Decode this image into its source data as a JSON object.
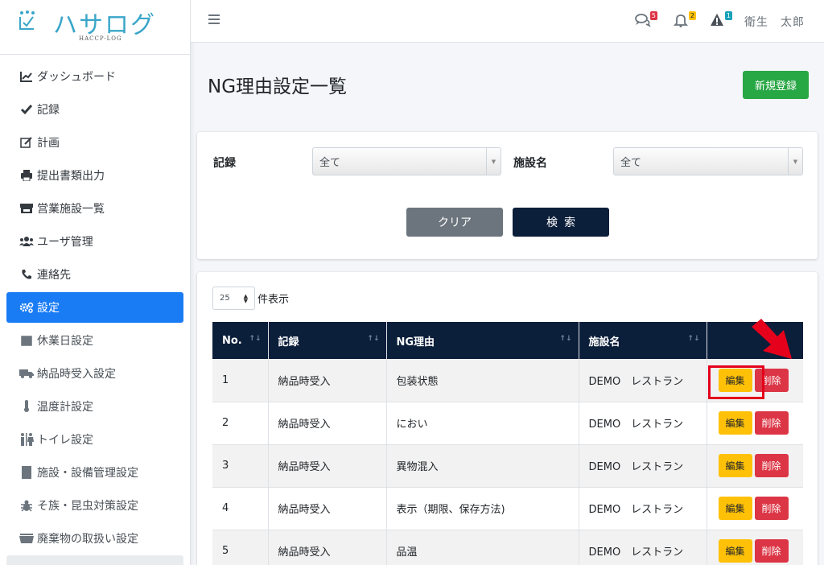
{
  "brand": {
    "name": "ハサログ",
    "sub": "HACCP-LOG"
  },
  "sidebar": {
    "items": [
      {
        "label": "ダッシュボード",
        "icon": "chart-line-icon"
      },
      {
        "label": "記録",
        "icon": "check-icon"
      },
      {
        "label": "計画",
        "icon": "edit-icon"
      },
      {
        "label": "提出書類出力",
        "icon": "print-icon"
      },
      {
        "label": "営業施設一覧",
        "icon": "store-icon"
      },
      {
        "label": "ユーザ管理",
        "icon": "users-icon"
      },
      {
        "label": "連絡先",
        "icon": "phone-icon"
      },
      {
        "label": "設定",
        "icon": "cogs-icon",
        "active": true
      },
      {
        "label": "休業日設定",
        "icon": "calendar-icon"
      },
      {
        "label": "納品時受入設定",
        "icon": "truck-icon"
      },
      {
        "label": "温度計設定",
        "icon": "thermometer-icon"
      },
      {
        "label": "トイレ設定",
        "icon": "restroom-icon"
      },
      {
        "label": "施設・設備管理設定",
        "icon": "building-icon"
      },
      {
        "label": "そ族・昆虫対策設定",
        "icon": "bug-icon"
      },
      {
        "label": "廃棄物の取扱い設定",
        "icon": "dumpster-icon"
      }
    ]
  },
  "topbar": {
    "messages_badge": "5",
    "notifications_badge": "2",
    "alerts_badge": "1",
    "user": "衛生　太郎"
  },
  "page": {
    "title": "NG理由設定一覧",
    "new_button": "新規登録"
  },
  "search": {
    "record_label": "記録",
    "record_value": "全て",
    "facility_label": "施設名",
    "facility_value": "全て",
    "clear_button": "クリア",
    "search_button": "検索"
  },
  "list": {
    "page_size": "25",
    "page_size_label": "件表示",
    "columns": [
      "No.",
      "記録",
      "NG理由",
      "施設名",
      ""
    ],
    "edit_label": "編集",
    "delete_label": "削除",
    "rows": [
      {
        "no": "1",
        "record": "納品時受入",
        "reason": "包装状態",
        "facility": "DEMO　レストラン"
      },
      {
        "no": "2",
        "record": "納品時受入",
        "reason": "におい",
        "facility": "DEMO　レストラン"
      },
      {
        "no": "3",
        "record": "納品時受入",
        "reason": "異物混入",
        "facility": "DEMO　レストラン"
      },
      {
        "no": "4",
        "record": "納品時受入",
        "reason": "表示（期限、保存方法)",
        "facility": "DEMO　レストラン"
      },
      {
        "no": "5",
        "record": "納品時受入",
        "reason": "品温",
        "facility": "DEMO　レストラン"
      }
    ]
  },
  "colors": {
    "primary": "#1a7cf5",
    "navy": "#0b1e3a",
    "success": "#28a745",
    "warning": "#ffc107",
    "danger": "#dc3545",
    "annotation": "#e5001b"
  }
}
